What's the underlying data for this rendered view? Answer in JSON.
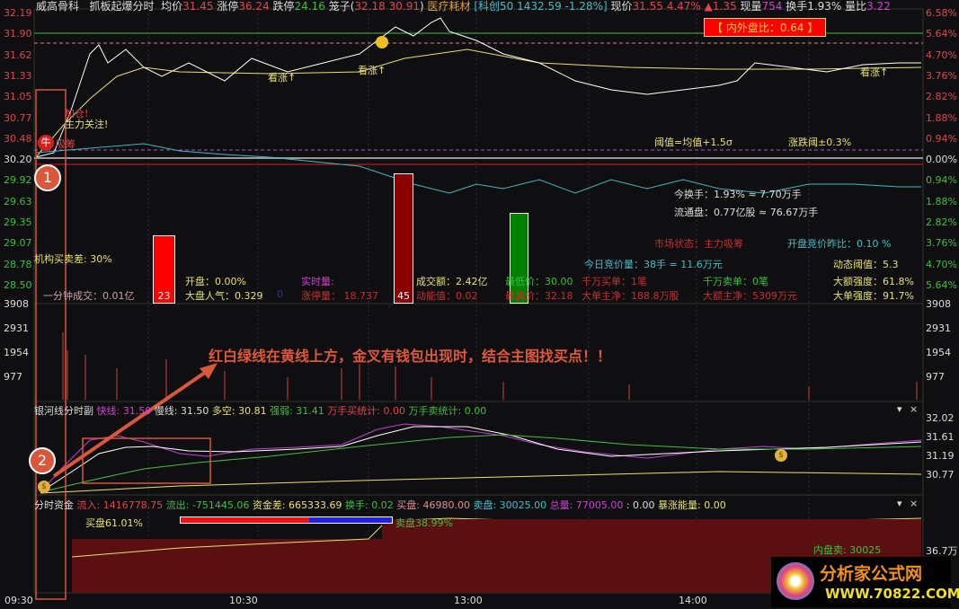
{
  "header": {
    "stock": "威高骨科",
    "indicator": "抓板起爆分时",
    "avg_label": "均价",
    "avg": "31.45",
    "limit_up_label": "涨停",
    "limit_up": "36.24",
    "limit_down_label": "跌停",
    "limit_down": "24.16",
    "cage_label": "笼子(",
    "cage_hi": "32.18",
    "cage_lo": "30.91",
    ")": ")",
    "sector": "医疗耗材",
    "index": "[科创50 1432.59 -1.28%]",
    "price_label": "现价",
    "price": "31.55",
    "pct": "4.47%",
    "chg": "▲1.35",
    "vol_label": "现量",
    "vol": "754",
    "turn_label": "换手",
    "turn": "1.93%",
    "ratio_label": "量比",
    "ratio": "3.22"
  },
  "axes": {
    "left_price": [
      "32.19",
      "31.90",
      "31.62",
      "31.33",
      "31.05",
      "30.77",
      "30.48",
      "30.20",
      "29.92",
      "29.63",
      "29.35",
      "29.07",
      "28.78",
      "28.50"
    ],
    "right_pct": [
      "6.58%",
      "5.64%",
      "4.70%",
      "3.76%",
      "2.82%",
      "1.88%",
      "0.94%",
      "0.00%",
      "0.94%",
      "1.88%",
      "2.82%",
      "3.76%",
      "4.70%",
      "5.64%"
    ],
    "volume": [
      "3908",
      "2931",
      "1954",
      "977"
    ],
    "sub": [
      "32.02",
      "31.61",
      "31.19",
      "30.77"
    ],
    "fund": "36.7万",
    "time": [
      "09:30",
      "10:30",
      "13:00",
      "14:00"
    ]
  },
  "main": {
    "inout_ratio": "【 内外盘比：0.64 】",
    "kanzhang": "看涨↑",
    "jiacang": "加仓!",
    "zhuli": "主力关注!",
    "niu": "牛",
    "xichou": "吸筹",
    "threshold": "阈值=均值+1.5σ",
    "updown": "涨跌阈±0.3%",
    "turnover": "今换手：1.93% ≈ 7.70万手",
    "float": "流通盘：0.77亿股 ≈ 76.67万手"
  },
  "stats": {
    "inst": "机构买卖差: 30%",
    "one_min": "一分钟成交：0.01亿",
    "bar1": "23",
    "bar2": "45",
    "open": "开盘：0.00%",
    "mood": "大盘人气：0.329",
    "mood_zero": "0",
    "realtime": "实时量:",
    "limitvol": "涨停量： 18.737",
    "amount": "成交额：2.42亿",
    "energy": "动能值：0.02",
    "low": "最低价：30.00",
    "high": "最高价：32.18",
    "buy10m": "千万买单：1笔",
    "bignet": "大单主净：188.8万股",
    "sell10m": "千万卖单：0笔",
    "amtnet": "大额主净：5309万元",
    "state": "市场状态：主力吸筹",
    "auction": "今日竞价量：38手 = 11.6万元",
    "open_auction": "开盘竞价昨比：0.10  %",
    "dyn": "动态阈值：5.3",
    "amt_strength": "大额强度：61.8%",
    "big_strength": "大单强度：91.7%"
  },
  "annotation": {
    "text": "红白绿线在黄线上方，金叉有钱包出现时，结合主图找买点！！",
    "c1": "1",
    "c2": "2"
  },
  "sub": {
    "name": "银河线分时副",
    "fast": "快线: 31.50",
    "slow": "慢线: 31.50",
    "ls": "多空: 30.81",
    "strong": "强弱: 31.41",
    "buy": "万手买统计: 0.00",
    "sell": "万手卖统计: 0.00"
  },
  "fund": {
    "name": "分时资金",
    "in": "流入: 1416778.75",
    "out": "流出: -751445.06",
    "diff": "资金差: 665333.69",
    "turn": "换手: 0.02",
    "buy": "买盘: 46980.00",
    "sell": "卖盘: 30025.00",
    "total": "总量: 77005.00",
    "blank": ": 0.00",
    "surge": "暴涨能量: 0.00",
    "buy_pct": "买盘61.01%",
    "sell_pct": "卖盘38.99%",
    "inner": "内盘卖:   30025",
    "buy_frac": 0.6101
  },
  "logo": {
    "name": "分析家公式网",
    "url": "WWW.70822.COM"
  }
}
